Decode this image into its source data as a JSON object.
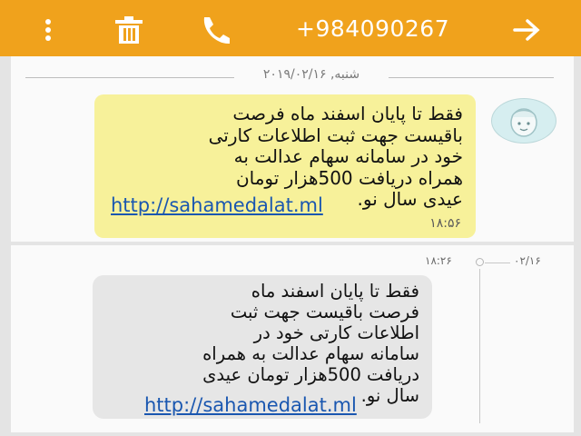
{
  "header": {
    "phone_number": "+984090267",
    "icons": [
      "more-vert-icon",
      "trash-icon",
      "phone-icon",
      "arrow-right-icon"
    ],
    "background": "#f0a21c"
  },
  "thread": {
    "date_divider": "شنبه, ۲۰۱۹/۰۲/۱۶"
  },
  "messages": [
    {
      "text": "فقط تا پایان اسفند ماه فرصت\nباقیست جهت ثبت اطلاعات کارتی\nخود در سامانه سهام عدالت به\nهمراه دریافت 500هزار تومان\nعیدی سال نو.",
      "link": "http://sahamedalat.ml",
      "time": "۱۸:۵۶",
      "bubble_color": "#f7f19a"
    },
    {
      "text": "فقط تا پایان اسفند ماه\nفرصت باقیست جهت ثبت\nاطلاعات کارتی خود در\nسامانه سهام عدالت به همراه\nدریافت 500هزار تومان عیدی\nسال نو.",
      "link": "http://sahamedalat.ml",
      "time": "۱۸:۲۶",
      "date": "۰۲/۱۶",
      "bubble_color": "#e6e6e6"
    }
  ]
}
